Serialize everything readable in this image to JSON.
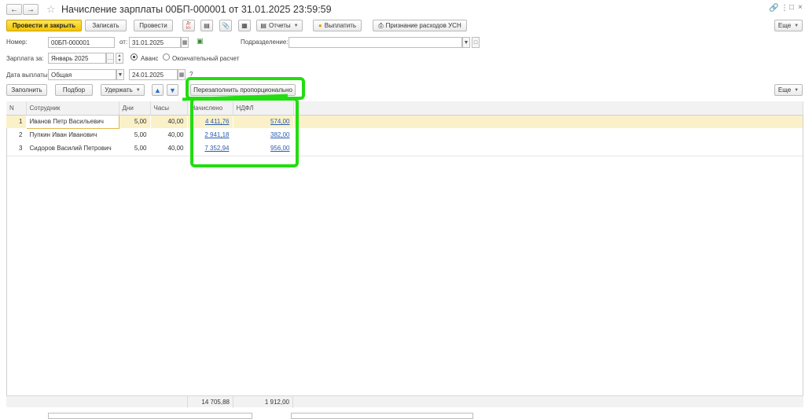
{
  "window": {
    "title": "Начисление зарплаты 00БП-000001 от 31.01.2025 23:59:59",
    "more_label": "Еще"
  },
  "toolbar": {
    "post_close": "Провести и закрыть",
    "save": "Записать",
    "post": "Провести",
    "reports": "Отчеты",
    "pay": "Выплатить",
    "usn": "Признание расходов УСН"
  },
  "form": {
    "number_label": "Номер:",
    "number_value": "00БП-000001",
    "from_label": "от:",
    "from_value": "31.01.2025",
    "dept_label": "Подразделение:",
    "dept_value": "",
    "salary_for_label": "Зарплата за:",
    "salary_for_value": "Январь 2025",
    "advance_label": "Аванс",
    "final_label": "Окончательный расчет",
    "pay_date_label": "Дата выплаты:",
    "pay_date_type": "Общая",
    "pay_date_value": "24.01.2025",
    "help_mark": "?"
  },
  "table_toolbar": {
    "fill": "Заполнить",
    "pick": "Подбор",
    "withhold": "Удержать",
    "refill": "Перезаполнить пропорционально",
    "more": "Еще"
  },
  "table": {
    "columns": [
      "N",
      "Сотрудник",
      "Дни",
      "Часы",
      "Начислено",
      "НДФЛ"
    ],
    "rows": [
      {
        "n": "1",
        "name": "Иванов Петр Васильевич",
        "days": "5,00",
        "hours": "40,00",
        "accrued": "4 411,76",
        "ndfl": "574,00"
      },
      {
        "n": "2",
        "name": "Пупкин Иван Иванович",
        "days": "5,00",
        "hours": "40,00",
        "accrued": "2 941,18",
        "ndfl": "382,00"
      },
      {
        "n": "3",
        "name": "Сидоров Василий Петрович",
        "days": "5,00",
        "hours": "40,00",
        "accrued": "7 352,94",
        "ndfl": "956,00"
      }
    ],
    "totals": {
      "accrued": "14 705,88",
      "ndfl": "1 912,00"
    }
  },
  "colors": {
    "primary": "#f5c400",
    "highlight": "#22dd11",
    "selected_row": "#fbf1c9",
    "link": "#2a5db0"
  }
}
